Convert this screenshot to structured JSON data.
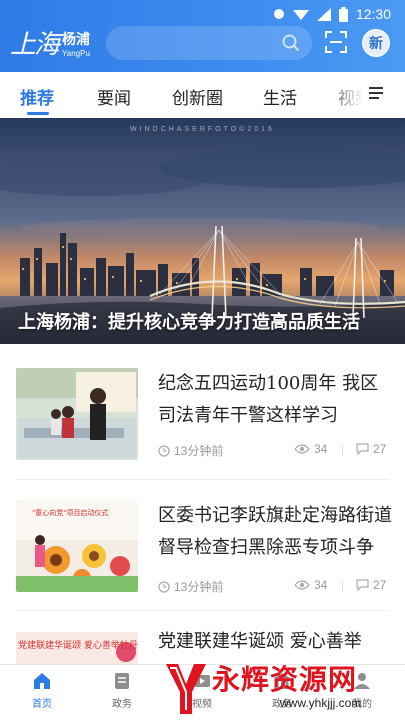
{
  "status_bar": {
    "time": "12:30"
  },
  "header": {
    "logo_script": "上海",
    "logo_cn": "杨浦",
    "logo_en": "YangPu",
    "avatar_text": "新"
  },
  "tabs": [
    {
      "label": "推荐",
      "active": true
    },
    {
      "label": "要闻",
      "active": false
    },
    {
      "label": "创新圈",
      "active": false
    },
    {
      "label": "生活",
      "active": false
    },
    {
      "label": "视频",
      "active": false
    }
  ],
  "hero": {
    "title": "上海杨浦：提升核心竞争力打造高品质生活",
    "watermark": "WINDCHASERFOTO©2016"
  },
  "news": [
    {
      "title": "纪念五四运动100周年 我区司法青年干警这样学习",
      "time": "13分钟前",
      "views": "34",
      "comments": "27"
    },
    {
      "title": "区委书记李跃旗赴定海路街道督导检查扫黑除恶专项斗争",
      "time": "13分钟前",
      "views": "34",
      "comments": "27"
    },
    {
      "title": "党建联建华诞颂 爱心善举",
      "time": "",
      "views": "",
      "comments": ""
    }
  ],
  "thumb_text": {
    "banner2": "\"童心向党\"项目启动仪式",
    "banner3": "党建联建华诞颂 爱心善举牡丹"
  },
  "bottom_nav": [
    {
      "label": "首页",
      "icon": "home-icon",
      "active": true
    },
    {
      "label": "政务",
      "icon": "document-icon",
      "active": false
    },
    {
      "label": "视频",
      "icon": "video-icon",
      "active": false
    },
    {
      "label": "政务",
      "icon": "government-icon",
      "active": false
    },
    {
      "label": "我的",
      "icon": "user-icon",
      "active": false
    }
  ],
  "overlay_watermark": {
    "text": "永辉资源网",
    "url": "www.yhkjjj.com"
  },
  "colors": {
    "brand": "#2f7be6",
    "overlay_red": "#e0141e"
  }
}
